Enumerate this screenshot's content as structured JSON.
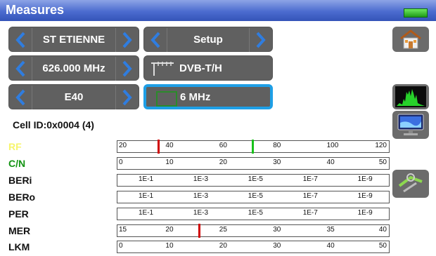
{
  "window": {
    "title": "Measures"
  },
  "controls": {
    "location": "ST ETIENNE",
    "mode": "Setup",
    "frequency": "626.000 MHz",
    "standard": "DVB-T/H",
    "channel": "E40",
    "bandwidth": "6 MHz"
  },
  "cell_id": "Cell ID:0x0004 (4)",
  "measurements": [
    {
      "name": "RF",
      "color": "#f7f56b",
      "ticks": [
        "20",
        "40",
        "60",
        "80",
        "100",
        "120"
      ],
      "markers": [
        {
          "value": 35,
          "color": "#d00000"
        },
        {
          "value": 70,
          "color": "#18c21a"
        }
      ],
      "min": 20,
      "max": 120
    },
    {
      "name": "C/N",
      "color": "#129312",
      "ticks": [
        "0",
        "10",
        "20",
        "30",
        "40",
        "50"
      ],
      "markers": [],
      "min": 0,
      "max": 50
    },
    {
      "name": "BERi",
      "color": "#111111",
      "ticks": [
        "1E-1",
        "1E-3",
        "1E-5",
        "1E-7",
        "1E-9"
      ],
      "markers": [],
      "log": true
    },
    {
      "name": "BERo",
      "color": "#111111",
      "ticks": [
        "1E-1",
        "1E-3",
        "1E-5",
        "1E-7",
        "1E-9"
      ],
      "markers": [],
      "log": true
    },
    {
      "name": "PER",
      "color": "#111111",
      "ticks": [
        "1E-1",
        "1E-3",
        "1E-5",
        "1E-7",
        "1E-9"
      ],
      "markers": [],
      "log": true
    },
    {
      "name": "MER",
      "color": "#111111",
      "ticks": [
        "15",
        "20",
        "25",
        "30",
        "35",
        "40"
      ],
      "markers": [
        {
          "value": 22.5,
          "color": "#d00000"
        }
      ],
      "min": 15,
      "max": 40
    },
    {
      "name": "LKM",
      "color": "#111111",
      "ticks": [
        "0",
        "10",
        "20",
        "30",
        "40",
        "50"
      ],
      "markers": [],
      "min": 0,
      "max": 50
    }
  ],
  "colors": {
    "accent": "#1e9fe6"
  }
}
